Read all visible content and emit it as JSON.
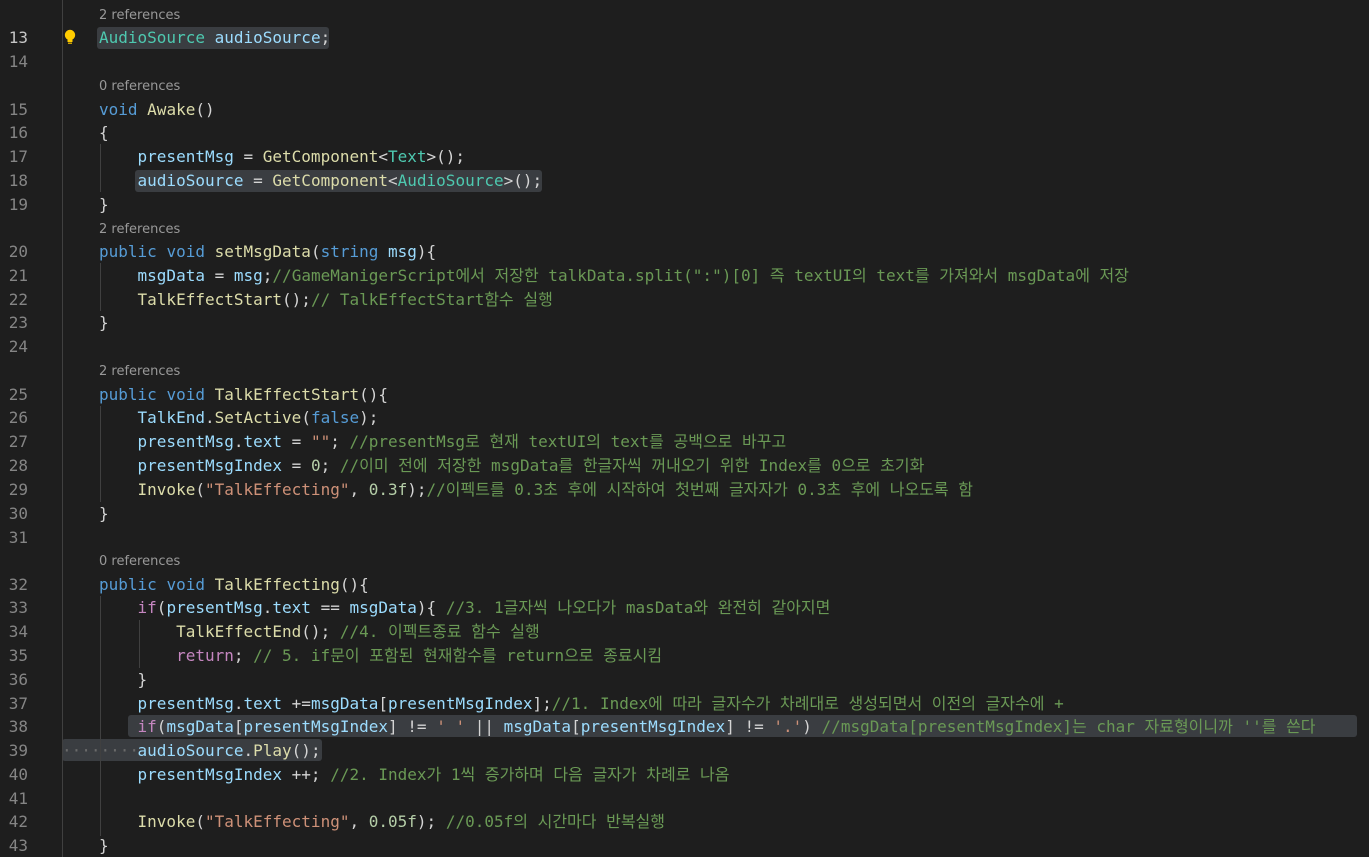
{
  "colors": {
    "background": "#1e1e1e",
    "line_number": "#858585",
    "codelens": "#999999",
    "keyword": "#569cd6",
    "type": "#4ec9b0",
    "identifier": "#9cdcfe",
    "function": "#dcdcaa",
    "string": "#ce9178",
    "number": "#b5cea8",
    "comment": "#6a9955",
    "control": "#c586c0",
    "selection": "#3a3d41"
  },
  "icons": {
    "lightbulb": "lightbulb-icon"
  },
  "lenses": [
    {
      "id": "L0",
      "text": "2 references"
    },
    {
      "id": "L1",
      "text": "0 references"
    },
    {
      "id": "L2",
      "text": "2 references"
    },
    {
      "id": "L3",
      "text": "2 references"
    },
    {
      "id": "L4",
      "text": "0 references"
    }
  ],
  "lines": [
    {
      "num": "13",
      "tokens": [
        [
          "type",
          "AudioSource"
        ],
        [
          "plain",
          " "
        ],
        [
          "id",
          "audioSource"
        ],
        [
          "plain",
          ";"
        ]
      ]
    },
    {
      "num": "14",
      "tokens": []
    },
    {
      "num": "15",
      "tokens": [
        [
          "kw",
          "void"
        ],
        [
          "plain",
          " "
        ],
        [
          "fn",
          "Awake"
        ],
        [
          "plain",
          "()"
        ]
      ]
    },
    {
      "num": "16",
      "tokens": [
        [
          "plain",
          "{"
        ]
      ]
    },
    {
      "num": "17",
      "tokens": [
        [
          "plain",
          "    "
        ],
        [
          "id",
          "presentMsg"
        ],
        [
          "plain",
          " = "
        ],
        [
          "fn",
          "GetComponent"
        ],
        [
          "plain",
          "<"
        ],
        [
          "type",
          "Text"
        ],
        [
          "plain",
          ">();"
        ]
      ]
    },
    {
      "num": "18",
      "tokens": [
        [
          "plain",
          "    "
        ],
        [
          "id",
          "audioSource"
        ],
        [
          "plain",
          " = "
        ],
        [
          "fn",
          "GetComponent"
        ],
        [
          "plain",
          "<"
        ],
        [
          "type",
          "AudioSource"
        ],
        [
          "plain",
          ">();"
        ]
      ]
    },
    {
      "num": "19",
      "tokens": [
        [
          "plain",
          "}"
        ]
      ]
    },
    {
      "num": "20",
      "tokens": [
        [
          "kw",
          "public"
        ],
        [
          "plain",
          " "
        ],
        [
          "kw",
          "void"
        ],
        [
          "plain",
          " "
        ],
        [
          "fn",
          "setMsgData"
        ],
        [
          "plain",
          "("
        ],
        [
          "kw",
          "string"
        ],
        [
          "plain",
          " "
        ],
        [
          "id",
          "msg"
        ],
        [
          "plain",
          "){"
        ]
      ]
    },
    {
      "num": "21",
      "tokens": [
        [
          "plain",
          "    "
        ],
        [
          "id",
          "msgData"
        ],
        [
          "plain",
          " = "
        ],
        [
          "id",
          "msg"
        ],
        [
          "plain",
          ";"
        ],
        [
          "cmt",
          "//GameManigerScript에서 저장한 talkData.split(\":\")[0] 즉 textUI의 text를 가져와서 msgData에 저장"
        ]
      ]
    },
    {
      "num": "22",
      "tokens": [
        [
          "plain",
          "    "
        ],
        [
          "fn",
          "TalkEffectStart"
        ],
        [
          "plain",
          "();"
        ],
        [
          "cmt",
          "// TalkEffectStart함수 실행"
        ]
      ]
    },
    {
      "num": "23",
      "tokens": [
        [
          "plain",
          "}"
        ]
      ]
    },
    {
      "num": "24",
      "tokens": []
    },
    {
      "num": "25",
      "tokens": [
        [
          "kw",
          "public"
        ],
        [
          "plain",
          " "
        ],
        [
          "kw",
          "void"
        ],
        [
          "plain",
          " "
        ],
        [
          "fn",
          "TalkEffectStart"
        ],
        [
          "plain",
          "(){"
        ]
      ]
    },
    {
      "num": "26",
      "tokens": [
        [
          "plain",
          "    "
        ],
        [
          "id",
          "TalkEnd"
        ],
        [
          "plain",
          "."
        ],
        [
          "fn",
          "SetActive"
        ],
        [
          "plain",
          "("
        ],
        [
          "kw",
          "false"
        ],
        [
          "plain",
          ");"
        ]
      ]
    },
    {
      "num": "27",
      "tokens": [
        [
          "plain",
          "    "
        ],
        [
          "id",
          "presentMsg"
        ],
        [
          "plain",
          "."
        ],
        [
          "id",
          "text"
        ],
        [
          "plain",
          " = "
        ],
        [
          "str",
          "\"\""
        ],
        [
          "plain",
          "; "
        ],
        [
          "cmt",
          "//presentMsg로 현재 textUI의 text를 공백으로 바꾸고"
        ]
      ]
    },
    {
      "num": "28",
      "tokens": [
        [
          "plain",
          "    "
        ],
        [
          "id",
          "presentMsgIndex"
        ],
        [
          "plain",
          " = "
        ],
        [
          "num",
          "0"
        ],
        [
          "plain",
          "; "
        ],
        [
          "cmt",
          "//이미 전에 저장한 msgData를 한글자씩 꺼내오기 위한 Index를 0으로 초기화"
        ]
      ]
    },
    {
      "num": "29",
      "tokens": [
        [
          "plain",
          "    "
        ],
        [
          "fn",
          "Invoke"
        ],
        [
          "plain",
          "("
        ],
        [
          "str",
          "\"TalkEffecting\""
        ],
        [
          "plain",
          ", "
        ],
        [
          "num",
          "0.3f"
        ],
        [
          "plain",
          ");"
        ],
        [
          "cmt",
          "//이펙트를 0.3초 후에 시작하여 첫번째 글자자가 0.3초 후에 나오도록 함"
        ]
      ]
    },
    {
      "num": "30",
      "tokens": [
        [
          "plain",
          "}"
        ]
      ]
    },
    {
      "num": "31",
      "tokens": []
    },
    {
      "num": "32",
      "tokens": [
        [
          "kw",
          "public"
        ],
        [
          "plain",
          " "
        ],
        [
          "kw",
          "void"
        ],
        [
          "plain",
          " "
        ],
        [
          "fn",
          "TalkEffecting"
        ],
        [
          "plain",
          "(){"
        ]
      ]
    },
    {
      "num": "33",
      "tokens": [
        [
          "plain",
          "    "
        ],
        [
          "ctrl",
          "if"
        ],
        [
          "plain",
          "("
        ],
        [
          "id",
          "presentMsg"
        ],
        [
          "plain",
          "."
        ],
        [
          "id",
          "text"
        ],
        [
          "plain",
          " == "
        ],
        [
          "id",
          "msgData"
        ],
        [
          "plain",
          "){ "
        ],
        [
          "cmt",
          "//3. 1글자씩 나오다가 masData와 완전히 같아지면"
        ]
      ]
    },
    {
      "num": "34",
      "tokens": [
        [
          "plain",
          "        "
        ],
        [
          "fn",
          "TalkEffectEnd"
        ],
        [
          "plain",
          "(); "
        ],
        [
          "cmt",
          "//4. 이펙트종료 함수 실행"
        ]
      ]
    },
    {
      "num": "35",
      "tokens": [
        [
          "plain",
          "        "
        ],
        [
          "ctrl",
          "return"
        ],
        [
          "plain",
          "; "
        ],
        [
          "cmt",
          "// 5. if문이 포함된 현재함수를 return으로 종료시킴"
        ]
      ]
    },
    {
      "num": "36",
      "tokens": [
        [
          "plain",
          "    }"
        ]
      ]
    },
    {
      "num": "37",
      "tokens": [
        [
          "plain",
          "    "
        ],
        [
          "id",
          "presentMsg"
        ],
        [
          "plain",
          "."
        ],
        [
          "id",
          "text"
        ],
        [
          "plain",
          " +="
        ],
        [
          "id",
          "msgData"
        ],
        [
          "plain",
          "["
        ],
        [
          "id",
          "presentMsgIndex"
        ],
        [
          "plain",
          "];"
        ],
        [
          "cmt",
          "//1. Index에 따라 글자수가 차례대로 생성되면서 이전의 글자수에 +"
        ]
      ]
    },
    {
      "num": "38",
      "tokens": [
        [
          "plain",
          "    "
        ],
        [
          "ctrl",
          "if"
        ],
        [
          "plain",
          "("
        ],
        [
          "id",
          "msgData"
        ],
        [
          "plain",
          "["
        ],
        [
          "id",
          "presentMsgIndex"
        ],
        [
          "plain",
          "] != "
        ],
        [
          "str",
          "' '"
        ],
        [
          "plain",
          " || "
        ],
        [
          "id",
          "msgData"
        ],
        [
          "plain",
          "["
        ],
        [
          "id",
          "presentMsgIndex"
        ],
        [
          "plain",
          "] != "
        ],
        [
          "str",
          "'.'"
        ],
        [
          "plain",
          ") "
        ],
        [
          "cmt",
          "//msgData[presentMsgIndex]는 char 자료형이니까 ''를 쓴다"
        ]
      ]
    },
    {
      "num": "39",
      "tokens": [
        [
          "plain",
          "    "
        ],
        [
          "id",
          "audioSource"
        ],
        [
          "plain",
          "."
        ],
        [
          "fn",
          "Play"
        ],
        [
          "plain",
          "();"
        ]
      ]
    },
    {
      "num": "40",
      "tokens": [
        [
          "plain",
          "    "
        ],
        [
          "id",
          "presentMsgIndex"
        ],
        [
          "plain",
          " ++; "
        ],
        [
          "cmt",
          "//2. Index가 1씩 증가하며 다음 글자가 차례로 나옴"
        ]
      ]
    },
    {
      "num": "41",
      "tokens": []
    },
    {
      "num": "42",
      "tokens": [
        [
          "plain",
          "    "
        ],
        [
          "fn",
          "Invoke"
        ],
        [
          "plain",
          "("
        ],
        [
          "str",
          "\"TalkEffecting\""
        ],
        [
          "plain",
          ", "
        ],
        [
          "num",
          "0.05f"
        ],
        [
          "plain",
          "); "
        ],
        [
          "cmt",
          "//0.05f의 시간마다 반복실행"
        ]
      ]
    },
    {
      "num": "43",
      "tokens": [
        [
          "plain",
          "}"
        ]
      ]
    }
  ]
}
